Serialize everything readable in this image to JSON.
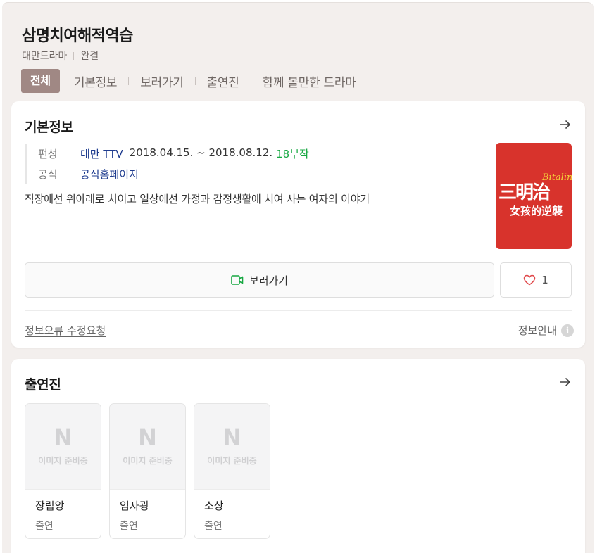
{
  "header": {
    "title": "삼명치여해적역습",
    "meta": [
      "대만드라마",
      "완결"
    ],
    "tabs": [
      "전체",
      "기본정보",
      "보러가기",
      "출연진",
      "함께 볼만한 드라마"
    ]
  },
  "basic_info": {
    "section_title": "기본정보",
    "broadcast_label": "편성",
    "broadcaster": "대만 TTV",
    "period": "2018.04.15. ~ 2018.08.12.",
    "episodes": "18부작",
    "official_label": "공식",
    "official_link": "공식홈페이지",
    "description": "직장에선 위아래로 치이고 일상에선 가정과 감정생활에 치여 사는 여자의 이야기",
    "poster": {
      "line1": "三明治",
      "line2": "女孩的逆襲",
      "line3": "Bitalin",
      "color": "#d8332c"
    },
    "watch_label": "보러가기",
    "like_count": "1",
    "report_label": "정보오류 수정요청",
    "info_guide_label": "정보안내"
  },
  "cast": {
    "section_title": "출연진",
    "placeholder_logo": "N",
    "placeholder_text": "이미지 준비중",
    "members": [
      {
        "name": "장립앙",
        "role": "출연"
      },
      {
        "name": "임자굉",
        "role": "출연"
      },
      {
        "name": "소상",
        "role": "출연"
      }
    ]
  },
  "colors": {
    "accent": "#a08884",
    "link": "#1f3c8f",
    "green": "#17a842"
  }
}
